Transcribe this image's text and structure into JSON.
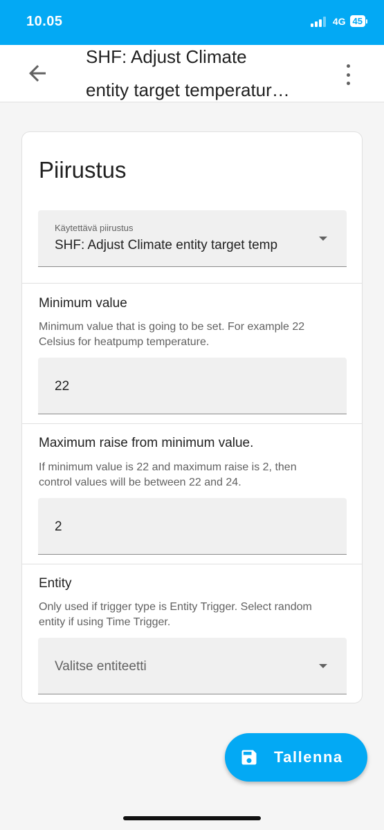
{
  "status_bar": {
    "time": "10.05",
    "network": "4G",
    "battery": "45"
  },
  "header": {
    "title_line1": "SHF: Adjust Climate",
    "title_line2": "entity target temperatur…"
  },
  "card": {
    "title": "Piirustus",
    "blueprint_select": {
      "label": "Käytettävä piirustus",
      "value": "SHF: Adjust Climate entity target temp"
    },
    "sections": [
      {
        "title": "Minimum value",
        "description": "Minimum value that is going to be set. For example 22 Celsius for heatpump temperature.",
        "value": "22"
      },
      {
        "title": "Maximum raise from minimum value.",
        "description": "If minimum value is 22 and maximum raise is 2, then control values will be between 22 and 24.",
        "value": "2"
      },
      {
        "title": "Entity",
        "description": "Only used if trigger type is Entity Trigger. Select random entity if using Time Trigger.",
        "placeholder": "Valitse entiteetti"
      }
    ]
  },
  "fab": {
    "label": "Tallenna"
  },
  "colors": {
    "accent": "#03a9f4",
    "field_bg": "#f0f0f0",
    "divider": "#e0e0e0"
  }
}
